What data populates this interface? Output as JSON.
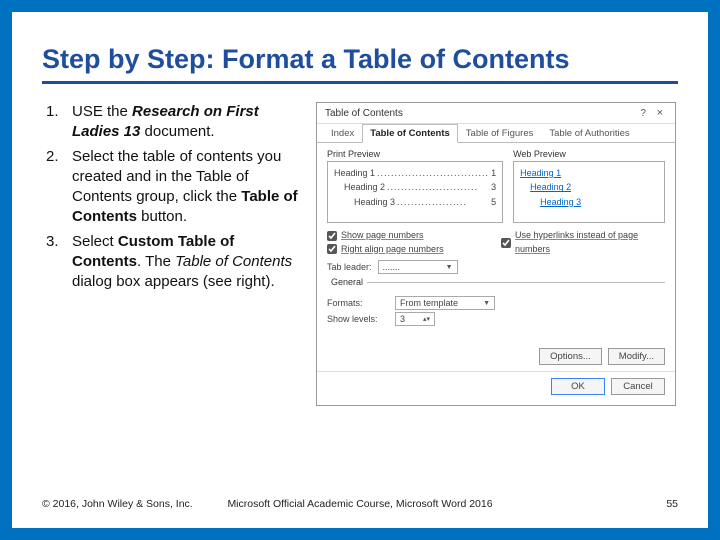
{
  "title": "Step by Step: Format a Table of Contents",
  "steps": {
    "s1": {
      "pre": "USE the ",
      "bold": "Research on First Ladies 13",
      "post": " document."
    },
    "s2": {
      "pre": "Select the table of contents you created and in the Table of Contents group, click the ",
      "bold": "Table of Contents",
      "post": " button."
    },
    "s3": {
      "pre": "Select ",
      "bold": "Custom Table of Contents",
      "mid": ". The ",
      "ital": "Table of Contents",
      "post": " dialog box appears (see right)."
    }
  },
  "dialog": {
    "title": "Table of Contents",
    "help": "?",
    "close": "×",
    "tabs": {
      "index": "Index",
      "toc": "Table of Contents",
      "tof": "Table of Figures",
      "toa": "Table of Authorities"
    },
    "printPreview": "Print Preview",
    "webPreview": "Web Preview",
    "pp": {
      "h1": "Heading 1",
      "h2": "Heading 2",
      "h3": "Heading 3",
      "p1": "1",
      "p2": "3",
      "p3": "5"
    },
    "wp": {
      "h1": "Heading 1",
      "h2": "Heading 2",
      "h3": "Heading 3"
    },
    "showPage": "Show page numbers",
    "rightAlign": "Right align page numbers",
    "useHyper": "Use hyperlinks instead of page numbers",
    "tabLeaderLabel": "Tab leader:",
    "tabLeaderVal": ".......",
    "general": "General",
    "formatsLabel": "Formats:",
    "formatsVal": "From template",
    "levelsLabel": "Show levels:",
    "levelsVal": "3",
    "optionsBtn": "Options...",
    "modifyBtn": "Modify...",
    "okBtn": "OK",
    "cancelBtn": "Cancel"
  },
  "footer": {
    "left": "© 2016, John Wiley & Sons, Inc.",
    "mid": "Microsoft Official Academic Course, Microsoft Word 2016",
    "page": "55"
  }
}
